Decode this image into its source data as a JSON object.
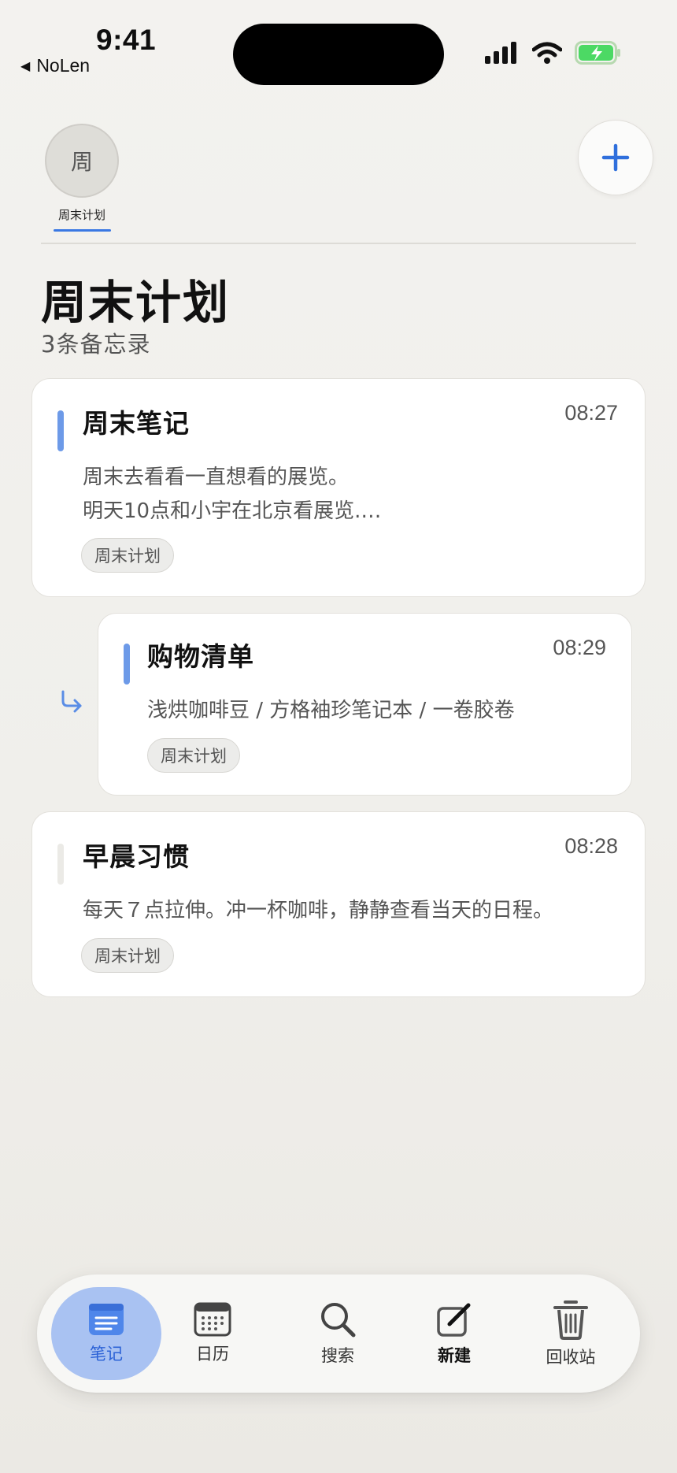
{
  "status_bar": {
    "time": "9:41",
    "back_app": "NoLen",
    "back_glyph": "◀"
  },
  "folders": {
    "chip_glyph": "周",
    "chip_label": "周末计划",
    "add_icon": "plus-icon"
  },
  "header": {
    "title": "周末计划",
    "count": "3条备忘录"
  },
  "notes": [
    {
      "title": "周末笔记",
      "time": "08:27",
      "body_lines": [
        "周末去看看一直想看的展览。",
        "明天10点和小宇在北京看展览.…"
      ],
      "tag": "周末计划",
      "accent": "#6d9ae8"
    },
    {
      "title": "购物清单",
      "time": "08:29",
      "body_lines": [
        "浅烘咖啡豆 / 方格袖珍笔记本 / 一卷胶卷"
      ],
      "tag": "周末计划",
      "accent": "#6d9ae8",
      "nested": true
    },
    {
      "title": "早晨习惯",
      "time": "08:28",
      "body_lines": [
        "每天７点拉伸。冲一杯咖啡，静静查看当天的日程。"
      ],
      "tag": "周末计划",
      "accent": "#ebeae6"
    }
  ],
  "tabbar": {
    "items": [
      {
        "label": "笔记",
        "icon": "notes-icon",
        "active": true
      },
      {
        "label": "日历",
        "icon": "calendar-icon"
      },
      {
        "label": "搜索",
        "icon": "search-icon"
      },
      {
        "label": "新建",
        "icon": "compose-icon"
      },
      {
        "label": "回收站",
        "icon": "trash-icon"
      }
    ]
  },
  "colors": {
    "accent": "#3a78e3",
    "active_tab": "#a9c2f2",
    "battery": "#4cd964"
  }
}
